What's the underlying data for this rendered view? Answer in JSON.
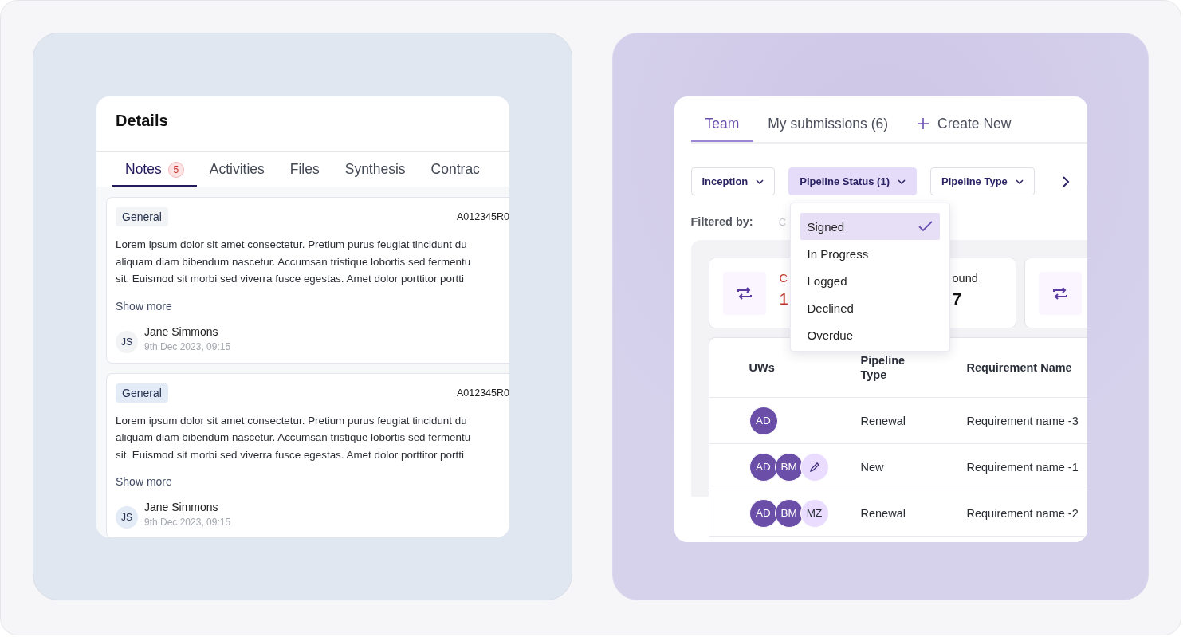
{
  "details": {
    "title": "Details",
    "tabs": [
      {
        "label": "Notes",
        "badge": "5",
        "selected": true
      },
      {
        "label": "Activities",
        "selected": false
      },
      {
        "label": "Files",
        "selected": false
      },
      {
        "label": "Synthesis",
        "selected": false
      },
      {
        "label": "Contrac",
        "selected": false
      }
    ],
    "notes": [
      {
        "tag": "General",
        "code": "A012345R0",
        "highlighted": false,
        "body": "Lorem ipsum dolor sit amet consectetur. Pretium purus feugiat tincidunt du\naliquam diam bibendum nascetur. Accumsan tristique lobortis sed fermentu\nsit. Euismod sit morbi sed viverra fusce egestas. Amet dolor porttitor portti",
        "more": "Show more",
        "initials": "JS",
        "author": "Jane Simmons",
        "date": "9th Dec 2023, 09:15"
      },
      {
        "tag": "General",
        "code": "A012345R0",
        "highlighted": true,
        "body": "Lorem ipsum dolor sit amet consectetur. Pretium purus feugiat tincidunt du\naliquam diam bibendum nascetur. Accumsan tristique lobortis sed fermentu\nsit. Euismod sit morbi sed viverra fusce egestas. Amet dolor porttitor portti",
        "more": "Show more",
        "initials": "JS",
        "author": "Jane Simmons",
        "date": "9th Dec 2023, 09:15"
      }
    ]
  },
  "pipeline": {
    "tabs": [
      {
        "label": "Team",
        "kind": "tab",
        "selected": true
      },
      {
        "label": "My submissions (6)",
        "kind": "tab",
        "selected": false
      },
      {
        "label": "Create New",
        "kind": "action",
        "selected": false
      }
    ],
    "filters": [
      {
        "label": "Inception",
        "selected": false
      },
      {
        "label": "Pipeline Status (1)",
        "selected": true
      },
      {
        "label": "Pipeline Type",
        "selected": false
      }
    ],
    "filtered_by": {
      "label": "Filtered by:",
      "chip": "C"
    },
    "dropdown": [
      {
        "label": "Signed",
        "selected": true
      },
      {
        "label": "In Progress",
        "selected": false
      },
      {
        "label": "Logged",
        "selected": false
      },
      {
        "label": "Declined",
        "selected": false
      },
      {
        "label": "Overdue",
        "selected": false
      }
    ],
    "stat_cards": [
      {
        "kind": "summary",
        "items": [
          {
            "label": "C",
            "value": "1",
            "alert": true
          },
          {
            "label": "ound",
            "value": "7",
            "alert": false
          }
        ]
      },
      {
        "kind": "icon_only"
      }
    ],
    "table": {
      "columns": [
        "UWs",
        "Pipeline Type",
        "Requirement Name"
      ],
      "rows": [
        {
          "uws": [
            {
              "kind": "member",
              "initials": "AD"
            }
          ],
          "type": "Renewal",
          "requirement": "Requirement name -3"
        },
        {
          "uws": [
            {
              "kind": "member",
              "initials": "AD"
            },
            {
              "kind": "member",
              "initials": "BM"
            },
            {
              "kind": "edit"
            }
          ],
          "type": "New",
          "requirement": "Requirement name -1"
        },
        {
          "uws": [
            {
              "kind": "member",
              "initials": "AD"
            },
            {
              "kind": "member",
              "initials": "BM"
            },
            {
              "kind": "pending",
              "initials": "MZ"
            }
          ],
          "type": "Renewal",
          "requirement": "Requirement name -2"
        }
      ]
    }
  }
}
